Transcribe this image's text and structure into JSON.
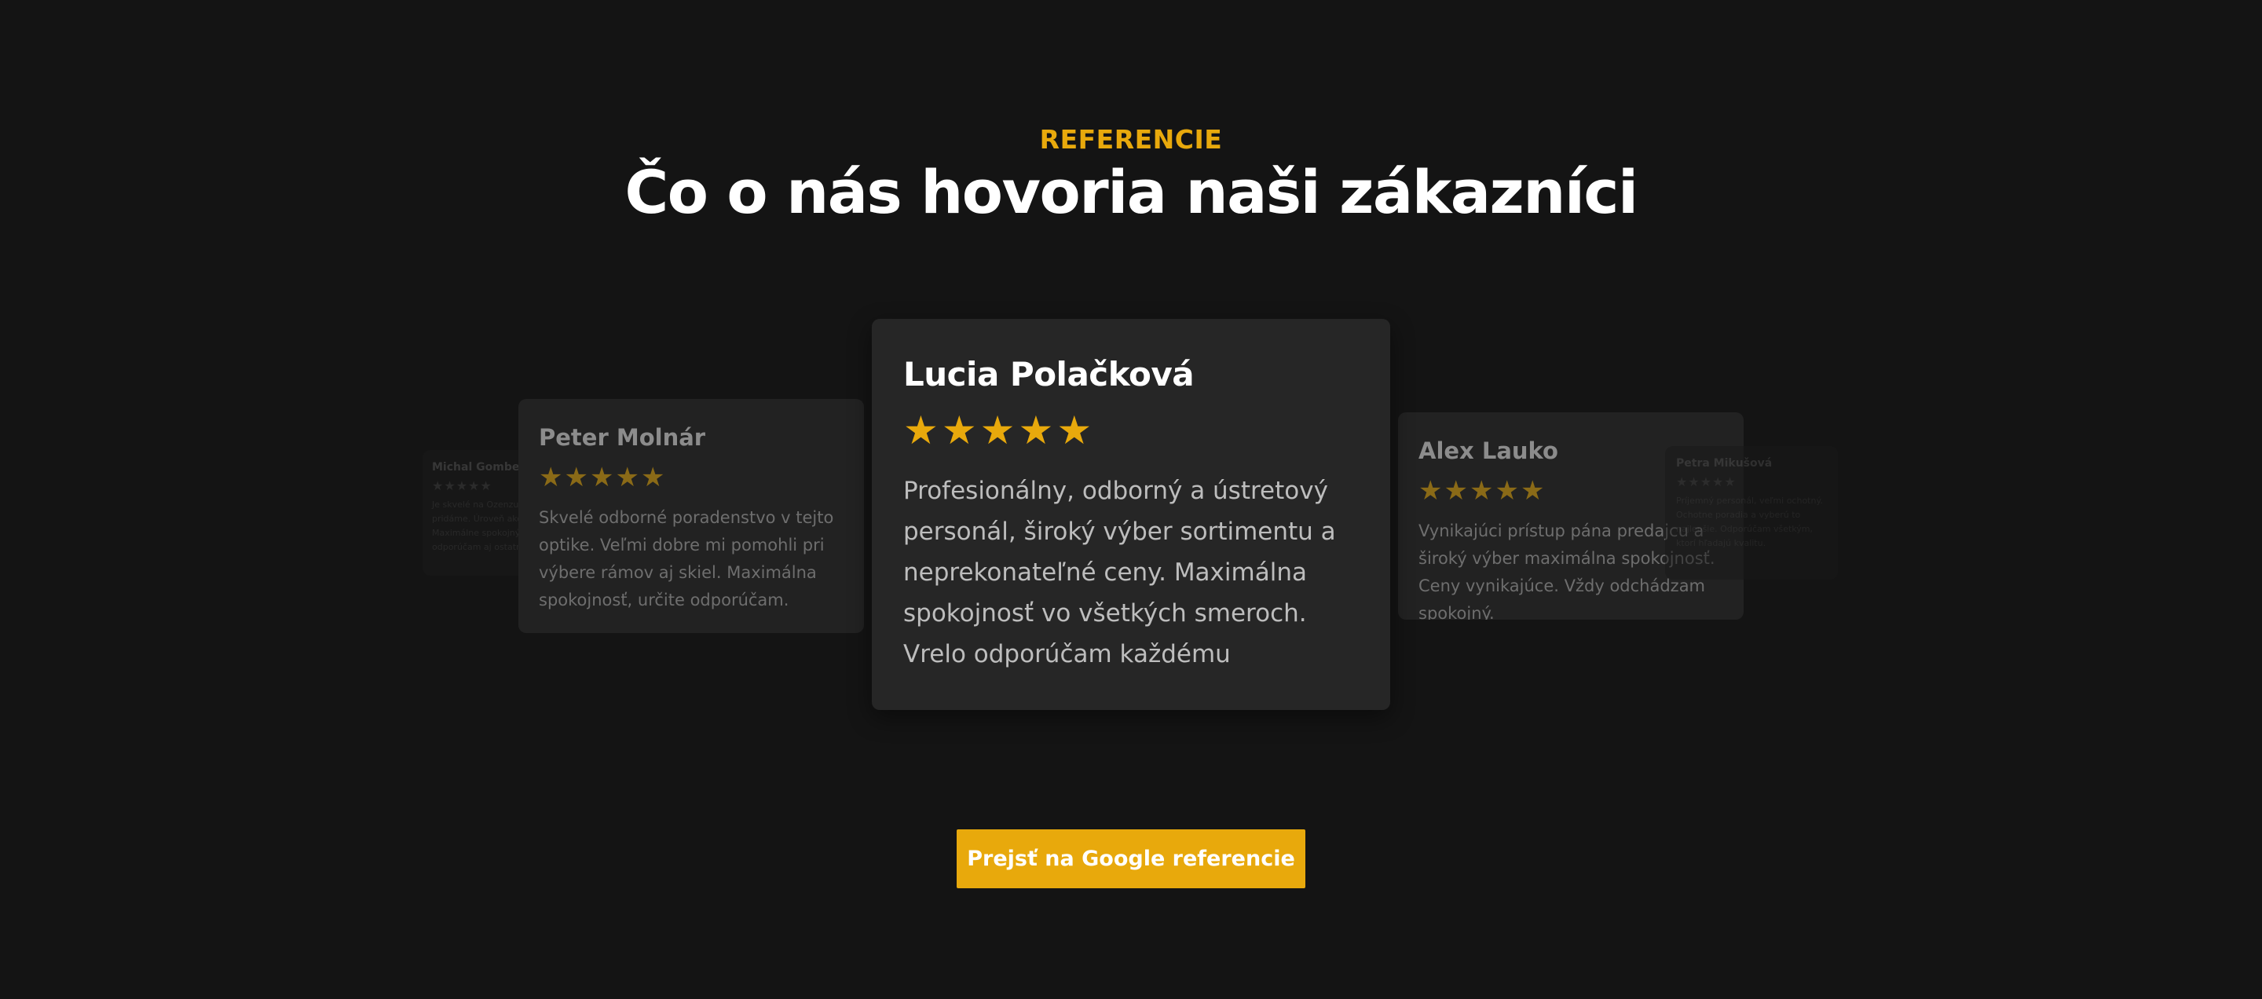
{
  "section": {
    "eyebrow": "REFERENCIE",
    "title": "Čo o nás hovoria naši zákazníci"
  },
  "rating_symbol": "★",
  "colors": {
    "background": "#141414",
    "accent": "#e8a90c",
    "card": "#262626",
    "title": "#ffffff"
  },
  "reviews": [
    {
      "name": "Michal Gombeš",
      "rating": 5,
      "text": "Je skvelé na Ozenzum cevtoty pridáme. Úroveň ako služby aj ceny. Maximálne spokojný. Vrele odporúčam aj ostatným."
    },
    {
      "name": "Peter Molnár",
      "rating": 5,
      "text": "Skvelé odborné poradenstvo v tejto optike. Veľmi dobre mi pomohli pri výbere rámov aj skiel. Maximálna spokojnosť, určite odporúčam."
    },
    {
      "name": "Lucia Polačková",
      "rating": 5,
      "text": "Profesionálny, odborný a ústretový personál, široký výber sortimentu a neprekonateľné ceny. Maximálna spokojnosť vo všetkých smeroch. Vrelo odporúčam každému"
    },
    {
      "name": "Alex Lauko",
      "rating": 5,
      "text": "Vynikajúci prístup pána predajcu a široký výber maximálna spokojnosť. Ceny vynikajúce. Vždy odchádzam spokojný."
    },
    {
      "name": "Petra Mikušová",
      "rating": 5,
      "text": "Príjemný personál, veľmi ochotný. Ochotne poradia a vyberú to najlepšie. Odporúčam všetkým, ktorí hľadajú kvalitu."
    }
  ],
  "cta": {
    "label": "Prejsť na Google referencie"
  }
}
